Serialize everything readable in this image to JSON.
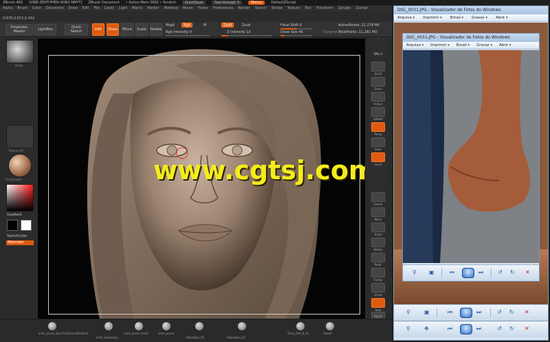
{
  "zbrush": {
    "title_items": [
      "ZBrush 4R5",
      "[VIBE-ZENT-PHEN AON3 NMYT]",
      "ZBrush Document",
      "• Active Mem 2882 • Scratch",
      "QuickSave",
      "See-through 0",
      "Menus",
      "DefaultZScript"
    ],
    "menu_items": [
      "Alpha",
      "Brush",
      "Color",
      "Document",
      "Draw",
      "Edit",
      "File",
      "Layer",
      "Light",
      "Macro",
      "Marker",
      "Material",
      "Movie",
      "Picker",
      "Preferences",
      "Render",
      "Stencil",
      "Stroke",
      "Texture",
      "Tool",
      "Transform",
      "Zplugin",
      "Zscript"
    ],
    "coords": "0.876,0.872,0.244",
    "toolbar": {
      "projection_master": "Projection Master",
      "lightbox": "LightBox",
      "quick_sketch": "Quick Sketch",
      "edit": "Edit",
      "draw": "Draw",
      "move": "Move",
      "scale": "Scale",
      "rotate": "Rotate",
      "mrgb": "Mrgb",
      "rgb": "Rgb",
      "m": "M",
      "rgb_intensity": "Rgb Intensity 0",
      "zadd": "Zadd",
      "zsub": "Zsub",
      "z_intensity": "Z Intensity 13",
      "focal_shift": "Focal Shift 0",
      "draw_size": "Draw Size 45",
      "dynamic": "Dynamic",
      "active_points": "ActivePoints: 11.278 Mil",
      "total_points": "TotalPoints: 11.281 Mil"
    },
    "left": {
      "brush_label": "Dollip",
      "texture_label": "Texture Off",
      "material_label": "SkinShade4",
      "gradient": "Gradient",
      "switch_color": "SwitchColor",
      "alternate": "Alternate"
    },
    "right_shelf": {
      "spix": "SPix 3",
      "items": [
        "Scroll",
        "Zoom",
        "Actual",
        "AAHalf",
        "Persp",
        "Floor",
        "Local",
        "Frame",
        "Move",
        "Scale",
        "Rotate",
        "PolyF",
        "Transp",
        "Ghost",
        "Solo",
        "Xpose"
      ]
    },
    "bottom": {
      "items": [
        "antic_pores_Spar-AnkoForsoRedlond",
        "antic_bottompo_",
        "antic_pores_small",
        "antic_pores",
        "AlphaRoja_01",
        "AlphaRoja_02",
        "Selvy_Fidl_B_01",
        "Rope2"
      ]
    },
    "colors": {
      "accent": "#e05a10",
      "bg": "#2b2b2b",
      "canvas": "#040404"
    }
  },
  "watermark": "www.cgtsj.com",
  "viewer_back": {
    "title": "DSC_0031.JPG - Visualizador de Fotos do Windows",
    "menu": [
      "Arquivo",
      "Imprimir",
      "Email",
      "Gravar",
      "Abrir"
    ]
  },
  "viewer_front": {
    "title": "DSC_0051.JPG - Visualizador de Fotos do Windows",
    "menu": [
      "Arquivo",
      "Imprimir",
      "Email",
      "Gravar",
      "Abrir"
    ]
  },
  "viewer_icons": [
    "zoom-icon",
    "actual-size-icon",
    "previous-icon",
    "slideshow-icon",
    "next-icon",
    "rotate-left-icon",
    "rotate-right-icon",
    "delete-icon"
  ]
}
